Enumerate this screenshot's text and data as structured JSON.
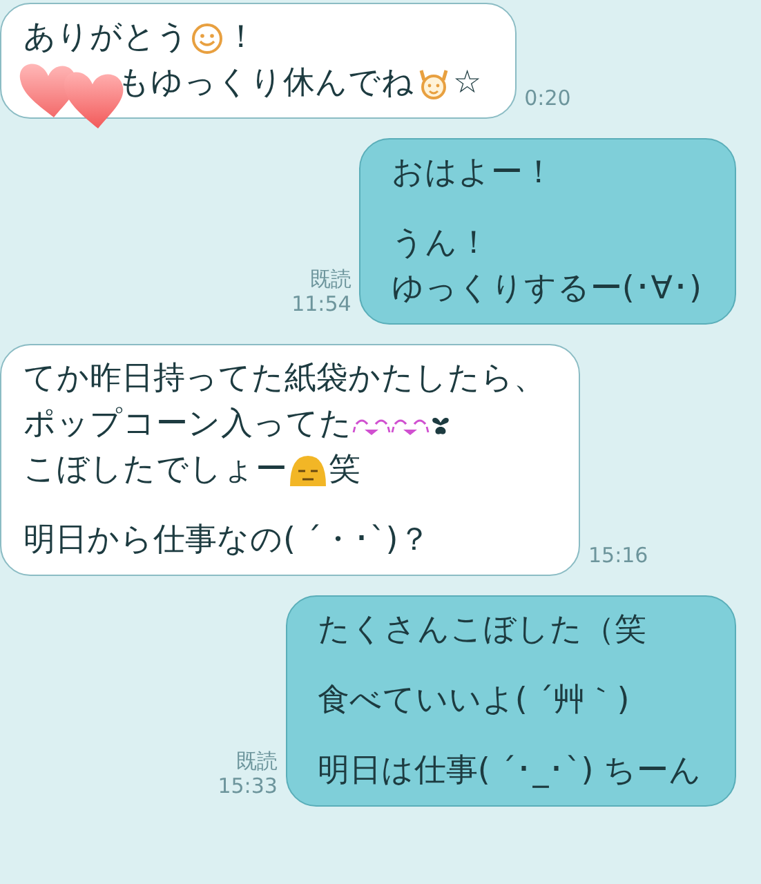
{
  "messages": [
    {
      "kind": "received",
      "time": "0:20",
      "sticker": {
        "kind": "hearts"
      },
      "paragraphs": [
        [
          [
            {
              "kind": "text",
              "text": "ありがとう"
            },
            {
              "kind": "smiley"
            },
            {
              "kind": "text",
              "text": "！"
            }
          ],
          [
            {
              "kind": "text",
              "text": "もゆっくり休んでね"
            },
            {
              "kind": "cheer"
            },
            {
              "kind": "text",
              "text": "☆"
            }
          ]
        ]
      ]
    },
    {
      "kind": "sent",
      "read": "既読",
      "time": "11:54",
      "paragraphs": [
        [
          [
            {
              "kind": "text",
              "text": "おはよー！"
            }
          ]
        ],
        [
          [
            {
              "kind": "text",
              "text": "うん！"
            }
          ],
          [
            {
              "kind": "text",
              "text": "ゆっくりするー(･∀･)"
            }
          ]
        ]
      ]
    },
    {
      "kind": "received",
      "time": "15:16",
      "paragraphs": [
        [
          [
            {
              "kind": "text",
              "text": "てか昨日持ってた紙袋かたしたら、"
            }
          ],
          [
            {
              "kind": "text",
              "text": "ポップコーン入ってた"
            },
            {
              "kind": "tears"
            },
            {
              "kind": "tears"
            },
            {
              "kind": "heart"
            }
          ],
          [
            {
              "kind": "text",
              "text": "こぼしたでしょー"
            },
            {
              "kind": "meh"
            },
            {
              "kind": "text",
              "text": "笑"
            }
          ]
        ],
        [
          [
            {
              "kind": "text",
              "text": "明日から仕事なの( ´・･`)？"
            }
          ]
        ]
      ]
    },
    {
      "kind": "sent",
      "read": "既読",
      "time": "15:33",
      "paragraphs": [
        [
          [
            {
              "kind": "text",
              "text": "たくさんこぼした（笑"
            }
          ]
        ],
        [
          [
            {
              "kind": "text",
              "text": "食べていいよ( ´艸｀)"
            }
          ]
        ],
        [
          [
            {
              "kind": "text",
              "text": "明日は仕事( ´･_･`) ちーん"
            }
          ]
        ]
      ]
    }
  ]
}
